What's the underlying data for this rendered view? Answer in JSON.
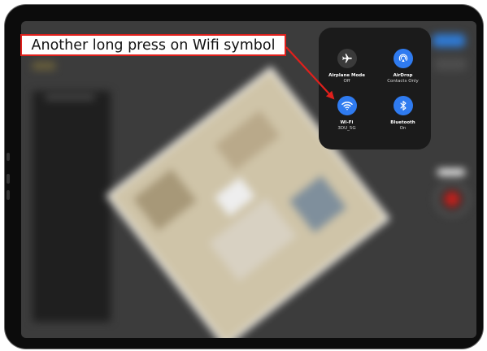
{
  "annotation": {
    "text": "Another long press on Wifi symbol",
    "color": "#e0201c"
  },
  "control_center": {
    "items": [
      {
        "icon": "airplane-icon",
        "label": "Airplane Mode",
        "status": "Off",
        "active": false,
        "color": "#3a3a3a"
      },
      {
        "icon": "airdrop-icon",
        "label": "AirDrop",
        "status": "Contacts Only",
        "active": true,
        "color": "#2f7bf0"
      },
      {
        "icon": "wifi-icon",
        "label": "Wi-Fi",
        "status": "3DU_5G",
        "active": true,
        "color": "#2f7bf0"
      },
      {
        "icon": "bluetooth-icon",
        "label": "Bluetooth",
        "status": "On",
        "active": true,
        "color": "#2f7bf0"
      }
    ]
  }
}
